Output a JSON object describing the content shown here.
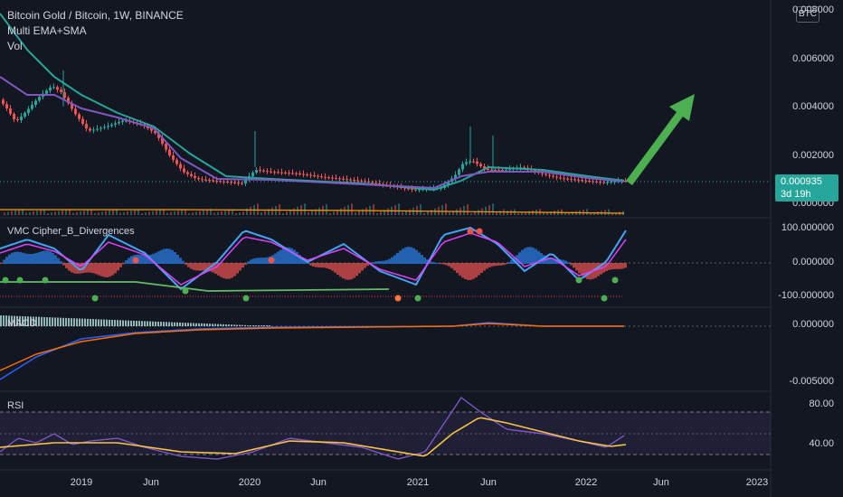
{
  "header": {
    "symbol_line": "Bitcoin Gold / Bitcoin, 1W, BINANCE",
    "indicator_1": "Multi EMA+SMA",
    "indicator_2": "Vol",
    "currency_badge": "BTC"
  },
  "price_axis": {
    "labels": [
      "0.008000",
      "0.006000",
      "0.004000",
      "0.002000",
      "0.000000"
    ],
    "last_price": "0.000935",
    "countdown": "3d 19h"
  },
  "oscillator_pane": {
    "name": "VMC Cipher_B_Divergences",
    "axis_labels": [
      "100.000000",
      "0.000000",
      "-100.000000"
    ]
  },
  "macd_pane": {
    "name": "MACD",
    "axis_labels": [
      "0.000000",
      "-0.005000"
    ]
  },
  "rsi_pane": {
    "name": "RSI",
    "axis_labels": [
      "80.00",
      "40.00"
    ]
  },
  "time_axis": {
    "labels": [
      "2019",
      "Jun",
      "2020",
      "Jun",
      "2021",
      "Jun",
      "2022",
      "Jun",
      "2023"
    ]
  },
  "colors": {
    "background": "#131722",
    "up": "#26a69a",
    "down": "#ef5350",
    "arrow": "#4caf50",
    "ema_teal": "#26a69a",
    "sma_blue": "#7e57c2",
    "rsi_line": "#7e57c2",
    "rsi_ma": "#f7c245"
  }
}
